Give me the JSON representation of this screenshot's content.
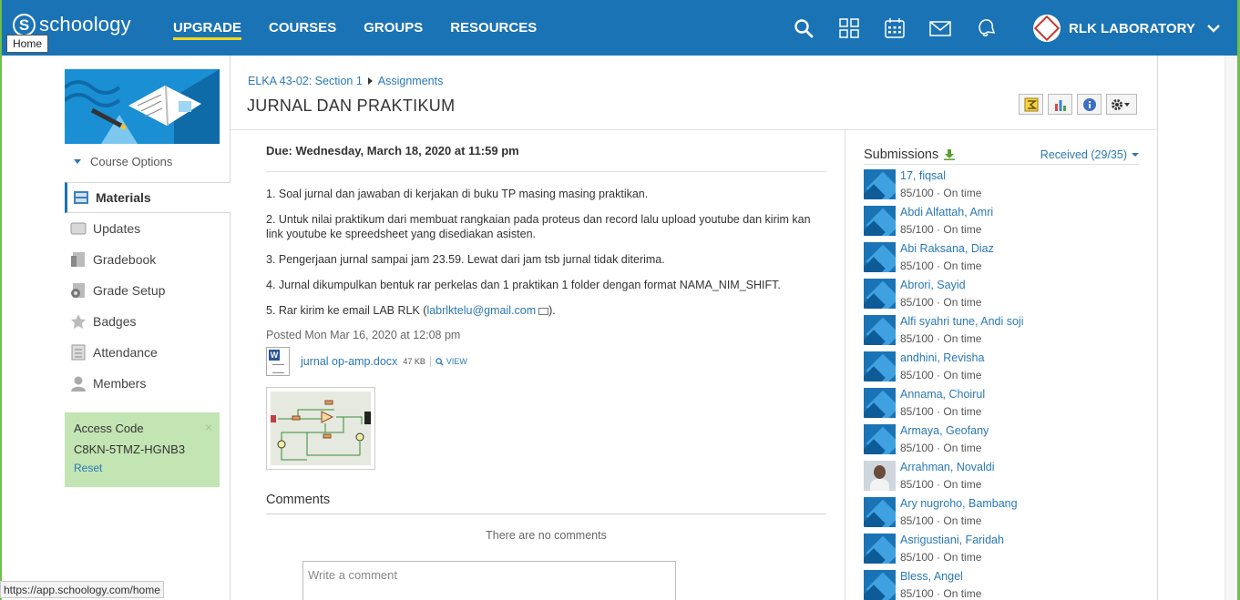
{
  "nav": {
    "logo_text": "schoology",
    "logo_mark": "S",
    "home_tooltip": "Home",
    "links": [
      "UPGRADE",
      "COURSES",
      "GROUPS",
      "RESOURCES"
    ],
    "active_link": "UPGRADE",
    "icons": [
      "search-icon",
      "apps-grid-icon",
      "calendar-icon",
      "mail-icon",
      "notifications-icon"
    ],
    "user_name": "RLK LABORATORY",
    "brand_color": "#1a73b5",
    "accent_underline": "#f1d71c"
  },
  "sidebar": {
    "course_options": "Course Options",
    "items": [
      {
        "label": "Materials",
        "icon": "folder-icon",
        "active": true
      },
      {
        "label": "Updates",
        "icon": "updates-icon"
      },
      {
        "label": "Gradebook",
        "icon": "gradebook-icon"
      },
      {
        "label": "Grade Setup",
        "icon": "grade-setup-icon"
      },
      {
        "label": "Badges",
        "icon": "badge-star-icon"
      },
      {
        "label": "Attendance",
        "icon": "attendance-icon"
      },
      {
        "label": "Members",
        "icon": "members-icon"
      }
    ],
    "access": {
      "title": "Access Code",
      "code": "C8KN-5TMZ-HGNB3",
      "reset": "Reset",
      "close": "×",
      "bg_color": "#c3e4b3"
    }
  },
  "header": {
    "breadcrumb": [
      "ELKA 43-02: Section 1",
      "Assignments"
    ],
    "title": "JURNAL DAN PRAKTIKUM",
    "tools": [
      "grade-icon",
      "chart-icon",
      "info-icon",
      "gear-icon"
    ]
  },
  "assignment": {
    "due": "Due: Wednesday, March 18, 2020 at 11:59 pm",
    "paragraphs": [
      "1. Soal jurnal dan jawaban di kerjakan di buku TP masing masing praktikan.",
      "2. Untuk nilai praktikum dari membuat rangkaian pada proteus dan record lalu upload youtube dan kirim kan link youtube ke spreedsheet yang disediakan asisten.",
      "3. Pengerjaan jurnal sampai jam 23.59. Lewat dari jam tsb jurnal tidak diterima.",
      "4. Jurnal dikumpulkan bentuk rar perkelas dan 1 praktikan 1 folder dengan format NAMA_NIM_SHIFT."
    ],
    "p5_prefix": "5. Rar kirim ke email LAB RLK (",
    "p5_email": "labrlktelu@gmail.com",
    "p5_suffix": ").",
    "posted": "Posted Mon Mar 16, 2020 at 12:08 pm",
    "attachment": {
      "name": "jurnal op-amp.docx",
      "size": "47 KB",
      "view": "VIEW"
    }
  },
  "comments": {
    "heading": "Comments",
    "empty": "There are no comments",
    "placeholder": "Write a comment"
  },
  "submissions": {
    "title": "Submissions",
    "received": "Received (29/35)",
    "items": [
      {
        "name": "17, fiqsal",
        "grade": "85/100",
        "status": "On time"
      },
      {
        "name": "Abdi Alfattah, Amri",
        "grade": "85/100",
        "status": "On time"
      },
      {
        "name": "Abi Raksana, Diaz",
        "grade": "85/100",
        "status": "On time"
      },
      {
        "name": "Abrori, Sayid",
        "grade": "85/100",
        "status": "On time"
      },
      {
        "name": "Alfi syahri tune, Andi soji",
        "grade": "85/100",
        "status": "On time"
      },
      {
        "name": "andhini, Revisha",
        "grade": "85/100",
        "status": "On time"
      },
      {
        "name": "Annama, Choirul",
        "grade": "85/100",
        "status": "On time"
      },
      {
        "name": "Armaya, Geofany",
        "grade": "85/100",
        "status": "On time"
      },
      {
        "name": "Arrahman, Novaldi",
        "grade": "85/100",
        "status": "On time",
        "photo": true
      },
      {
        "name": "Ary nugroho, Bambang",
        "grade": "85/100",
        "status": "On time"
      },
      {
        "name": "Asrigustiani, Faridah",
        "grade": "85/100",
        "status": "On time"
      },
      {
        "name": "Bless, Angel",
        "grade": "85/100",
        "status": "On time"
      }
    ]
  },
  "statusbar": {
    "url": "https://app.schoology.com/home"
  }
}
